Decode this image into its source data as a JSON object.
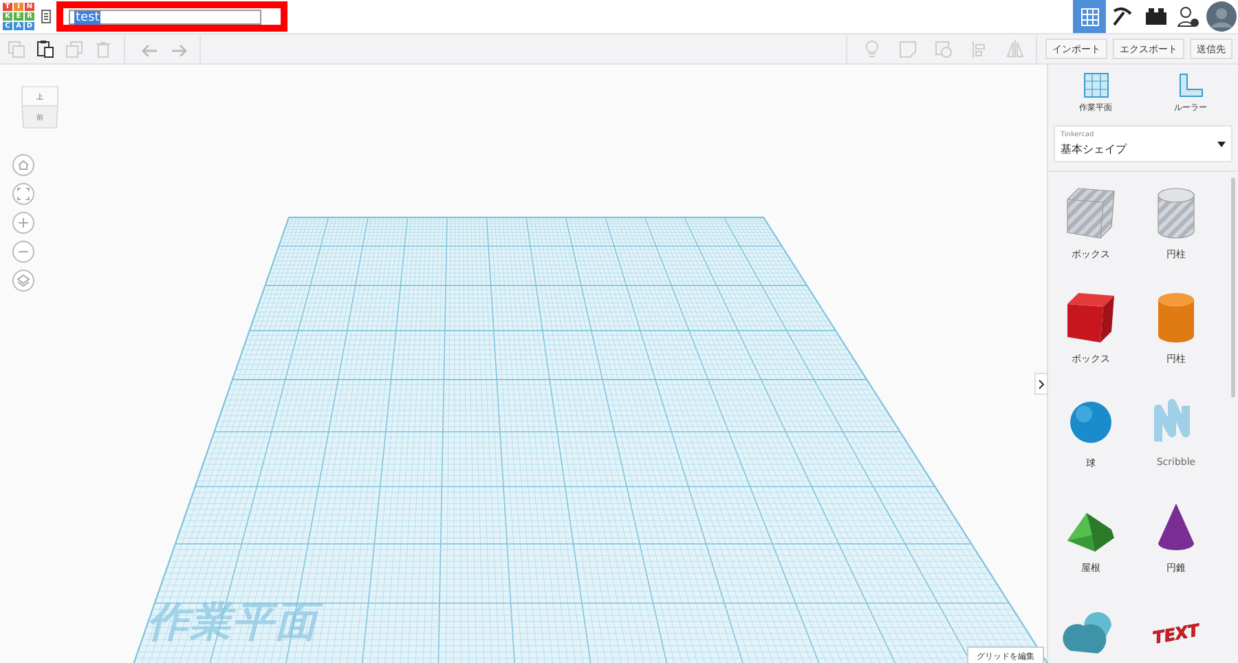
{
  "logo": {
    "letters": [
      {
        "text": "T",
        "color": "#e8473b"
      },
      {
        "text": "I",
        "color": "#f08a2c"
      },
      {
        "text": "N",
        "color": "#e8473b"
      },
      {
        "text": "K",
        "color": "#5bb04c"
      },
      {
        "text": "E",
        "color": "#5bb04c"
      },
      {
        "text": "R",
        "color": "#5bb04c"
      },
      {
        "text": "C",
        "color": "#3b8fd6"
      },
      {
        "text": "A",
        "color": "#3b8fd6"
      },
      {
        "text": "D",
        "color": "#3b8fd6"
      }
    ]
  },
  "title_field": {
    "value": "test"
  },
  "view_modes": [
    {
      "kind": "grid",
      "selected": true
    },
    {
      "kind": "pickaxe",
      "selected": false
    },
    {
      "kind": "bricks",
      "selected": false
    }
  ],
  "toolbar": {
    "buttons": [
      "インポート",
      "エクスポート",
      "送信先"
    ]
  },
  "view_cube": {
    "top": "上",
    "front": "前"
  },
  "workplane_label": "作業平面",
  "edit_grid_button": "グリッドを編集",
  "panel": {
    "tools": [
      {
        "kind": "workplane",
        "label": "作業平面"
      },
      {
        "kind": "ruler",
        "label": "ルーラー"
      }
    ],
    "library": {
      "caption": "Tinkercad",
      "value": "基本シェイプ"
    },
    "shapes": [
      {
        "kind": "box-hole",
        "label": "ボックス"
      },
      {
        "kind": "cylinder-hole",
        "label": "円柱"
      },
      {
        "kind": "box",
        "label": "ボックス"
      },
      {
        "kind": "cylinder",
        "label": "円柱"
      },
      {
        "kind": "sphere",
        "label": "球"
      },
      {
        "kind": "scribble",
        "label": "Scribble"
      },
      {
        "kind": "roof",
        "label": "屋根"
      },
      {
        "kind": "cone",
        "label": "円錐"
      },
      {
        "kind": "round-roof"
      },
      {
        "kind": "text",
        "art": "TEXT"
      }
    ]
  }
}
